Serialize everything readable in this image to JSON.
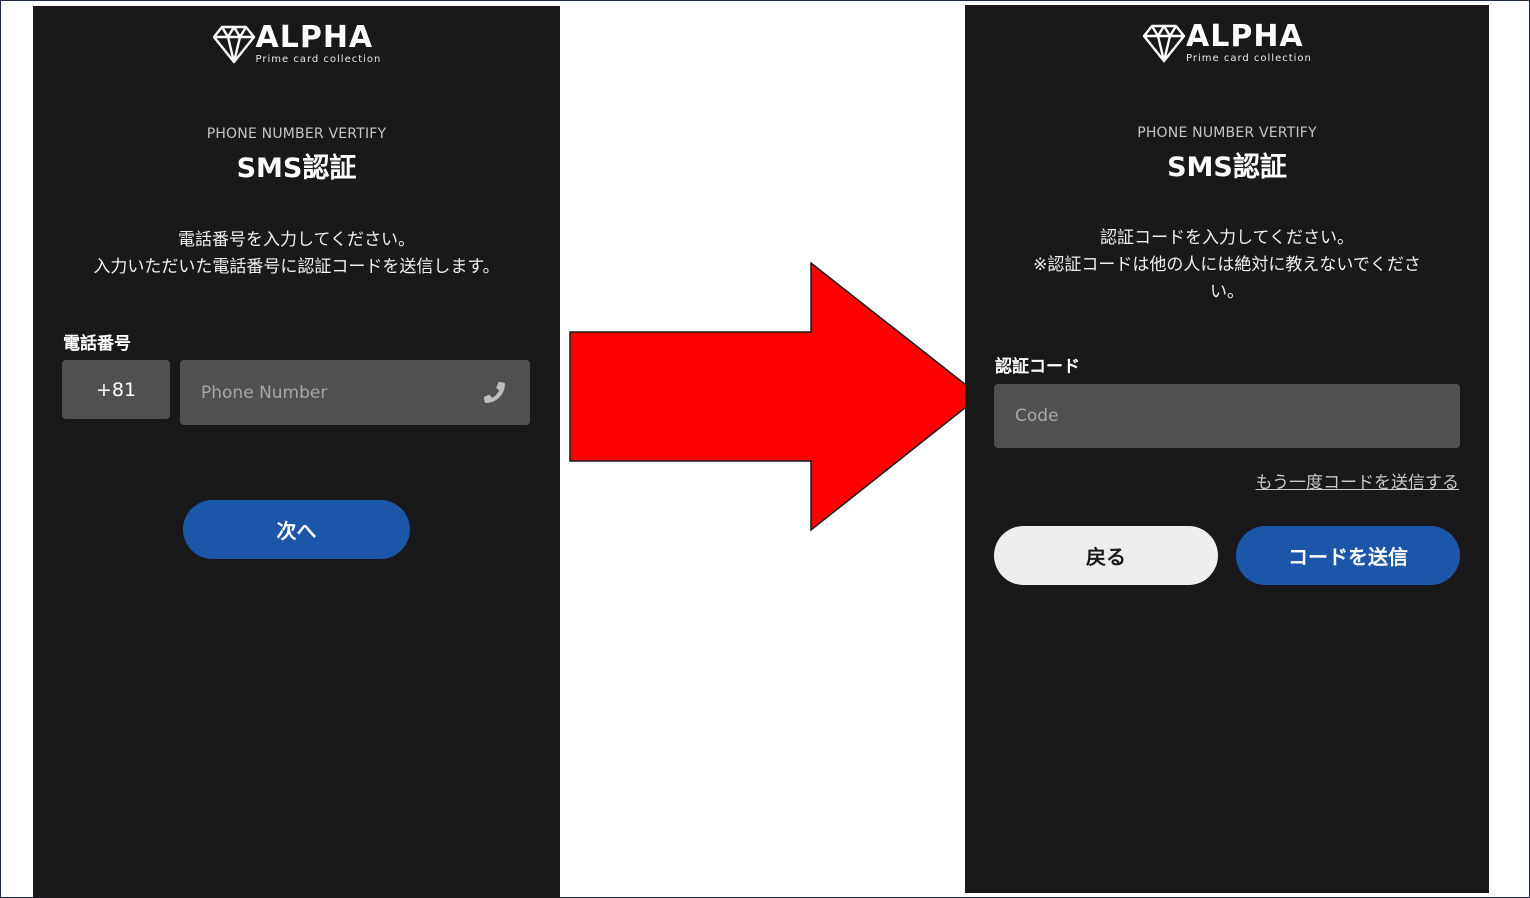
{
  "colors": {
    "panel_bg": "#19191b",
    "input_bg": "#505052",
    "primary_button": "#1c56a8",
    "secondary_button": "#eeeeee",
    "arrow": "#ff0000"
  },
  "brand": {
    "name": "ALPHA",
    "tagline": "Prime card collection",
    "icon": "diamond-icon"
  },
  "left_screen": {
    "subtitle": "PHONE NUMBER VERTIFY",
    "title": "SMS認証",
    "description_lines": [
      "電話番号を入力してください。",
      "入力いただいた電話番号に認証コードを送信します。"
    ],
    "phone_label": "電話番号",
    "country_code": "+81",
    "phone_placeholder": "Phone Number",
    "phone_icon": "phone-icon",
    "next_button": "次へ"
  },
  "right_screen": {
    "subtitle": "PHONE NUMBER VERTIFY",
    "title": "SMS認証",
    "description_lines": [
      "認証コードを入力してください。",
      "※認証コードは他の人には絶対に教えないでくださ",
      "い。"
    ],
    "code_label": "認証コード",
    "code_placeholder": "Code",
    "resend_link": "もう一度コードを送信する",
    "back_button": "戻る",
    "send_button": "コードを送信"
  },
  "transition_arrow": {
    "icon": "right-arrow-icon"
  }
}
